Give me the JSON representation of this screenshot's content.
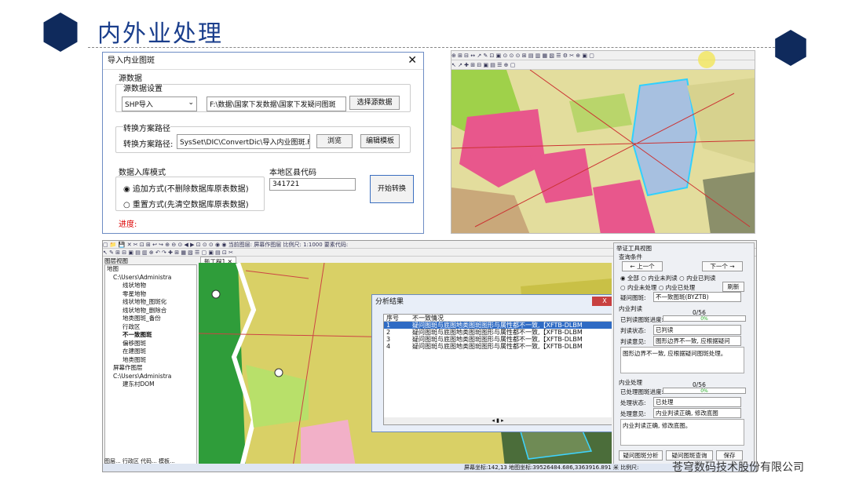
{
  "header": {
    "title": "内外业处理"
  },
  "footer": {
    "company": "苍穹数码技术股份有限公司"
  },
  "dialog": {
    "title": "导入内业图斑",
    "source_section": "源数据",
    "source_settings": "源数据设置",
    "source_type": "SHP导入",
    "source_path": "F:\\数据\\国家下发数据\\国家下发疑问图斑",
    "select_source_btn": "选择源数据",
    "plan_section": "转换方案路径",
    "plan_label": "转换方案路径:",
    "plan_path": "SysSet\\DIC\\ConvertDic\\导入内业图斑.Fa",
    "browse_btn": "浏览",
    "edit_template_btn": "编辑模板",
    "mode_section": "数据入库模式",
    "mode_append": "追加方式(不删除数据库原表数据)",
    "mode_replace": "重置方式(先清空数据库原表数据)",
    "region_label": "本地区县代码",
    "region_code": "341721",
    "start_btn": "开始转换",
    "progress_label": "进度:"
  },
  "app": {
    "toolbar_text": "当前图层: 屏幕作图层  比例尺: 1:1000  要素代码:",
    "tab": "新工程1",
    "panel_title": "图层视图",
    "layers": [
      "地图",
      "C:\\Users\\Administra",
      "线状地物",
      "零星地物",
      "线状地物_图斑化",
      "线状地物_删除合",
      "地类图斑_备份",
      "行政区",
      "不一致图斑",
      "偏移图斑",
      "在建图斑",
      "地类图斑",
      "屏幕作图层",
      "C:\\Users\\Administra",
      "建东村DOM"
    ],
    "bottom_tabs": "图层... 行政区 代码... 模板...",
    "status": "屏幕坐标:142,13   地图坐标:39526484.686,3363916.891 米  比例尺:"
  },
  "result": {
    "title": "分析结果",
    "close": "X",
    "col_no": "序号",
    "col_desc": "不一致情况",
    "rows": [
      {
        "no": "1",
        "desc": "疑问图斑与底图地类图斑图形与属性都不一致,【XFTB-DLBM"
      },
      {
        "no": "2",
        "desc": "疑问图斑与底图地类图斑图形与属性都不一致,【XFTB-DLBM"
      },
      {
        "no": "3",
        "desc": "疑问图斑与底图地类图斑图形与属性都不一致,【XFTB-DLBM"
      },
      {
        "no": "4",
        "desc": "疑问图斑与底图地类图斑图形与属性都不一致,【XFTB-DLBM"
      }
    ]
  },
  "check": {
    "title": "举证工具视图",
    "query": "查询条件",
    "prev": "← 上一个",
    "next": "下一个 →",
    "opt_all": "全部",
    "opt_unjudged": "内业未判读",
    "opt_judged": "内业已判读",
    "opt_unproc": "内业未处理",
    "opt_proc": "内业已处理",
    "refresh": "刷新",
    "doubt_label": "疑问图斑:",
    "doubt_val": "不一致图斑(BYZTB)",
    "inner_judge": "内业判读",
    "judged_progress": "已判读图斑进度:",
    "judge_count": "0/56",
    "judge_pct": "0%",
    "judge_state": "判读状态:",
    "judge_state_val": "已判读",
    "judge_opinion": "判读意见:",
    "judge_opinion_val": "图形边界不一致, 应根据疑问",
    "judge_text": "图形边界不一致, 应根据疑问图斑处理。",
    "outer": "内业处理",
    "proc_progress": "已处理图斑进度:",
    "proc_count": "0/56",
    "proc_pct": "0%",
    "proc_state": "处理状态:",
    "proc_state_val": "已处理",
    "proc_opinion": "处理意见:",
    "proc_opinion_val": "内业判读正确, 修改底图",
    "proc_text": "内业判读正确, 修改底图。",
    "btn_analyze": "疑问图斑分析",
    "btn_query": "疑问图斑查询",
    "btn_save": "保存"
  }
}
